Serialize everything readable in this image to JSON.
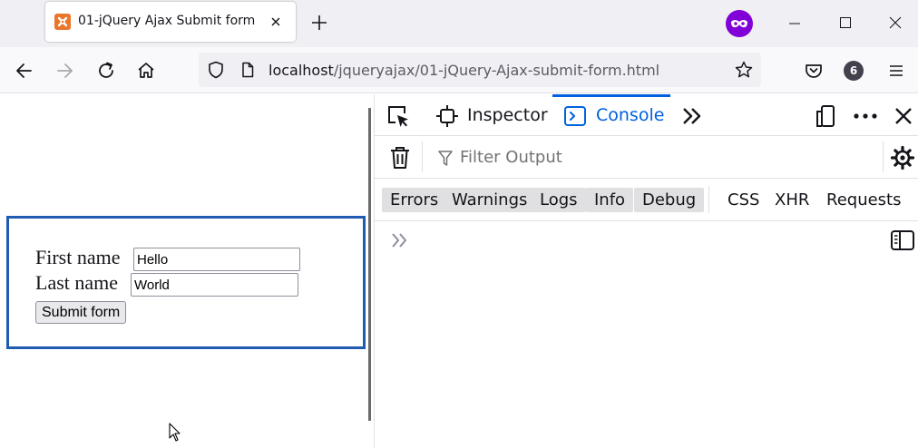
{
  "browser": {
    "tab": {
      "title": "01-jQuery Ajax Submit form"
    },
    "url": {
      "host": "localhost",
      "path": "/jqueryajax/01-jQuery-Ajax-submit-form.html"
    },
    "account_badge": "6"
  },
  "form": {
    "first_name_label": "First name",
    "first_name_value": "Hello",
    "last_name_label": "Last name",
    "last_name_value": "World",
    "submit_label": "Submit form"
  },
  "devtools": {
    "tabs": {
      "inspector": "Inspector",
      "console": "Console"
    },
    "filter_placeholder": "Filter Output",
    "levels": [
      "Errors",
      "Warnings",
      "Logs",
      "Info",
      "Debug"
    ],
    "requests": [
      "CSS",
      "XHR",
      "Requests"
    ]
  },
  "colors": {
    "accent": "#0061e0",
    "form_border": "#1f5bb0",
    "private_browsing": "#8000d7",
    "favicon": "#e9762b"
  },
  "icons": [
    "favicon-xampp-icon",
    "close-icon",
    "plus-icon",
    "private-browsing-icon",
    "minimize-icon",
    "maximize-icon",
    "close-window-icon",
    "back-arrow-icon",
    "forward-arrow-icon",
    "reload-icon",
    "home-icon",
    "shield-icon",
    "page-icon",
    "star-icon",
    "pocket-icon",
    "hamburger-menu-icon",
    "element-picker-icon",
    "inspector-icon",
    "console-icon",
    "chevrons-right-icon",
    "responsive-design-icon",
    "ellipsis-icon",
    "trash-icon",
    "filter-icon",
    "gear-icon",
    "sidebar-toggle-icon",
    "prompt-chevron-icon",
    "mouse-cursor-icon"
  ]
}
